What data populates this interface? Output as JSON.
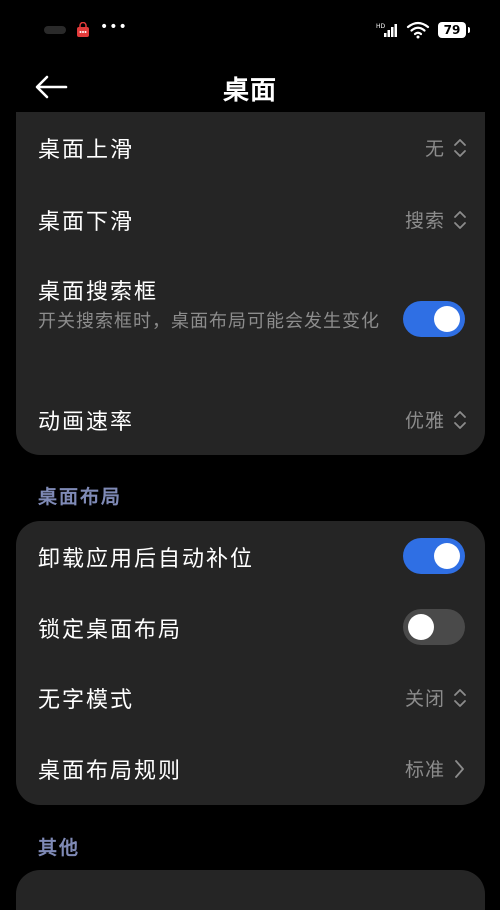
{
  "status_bar": {
    "battery": "79",
    "more_dots": "•••"
  },
  "header": {
    "title": "桌面"
  },
  "general_card": {
    "items": [
      {
        "label": "桌面上滑",
        "value": "无"
      },
      {
        "label": "桌面下滑",
        "value": "搜索"
      },
      {
        "label": "桌面搜索框",
        "description": "开关搜索框时，桌面布局可能会发生变化",
        "enabled": true
      },
      {
        "label": "动画速率",
        "value": "优雅"
      }
    ]
  },
  "layout_section": {
    "header": "桌面布局",
    "items": [
      {
        "label": "卸载应用后自动补位",
        "enabled": true
      },
      {
        "label": "锁定桌面布局",
        "enabled": false
      },
      {
        "label": "无字模式",
        "value": "关闭"
      },
      {
        "label": "桌面布局规则",
        "value": "标准"
      }
    ]
  },
  "other_section": {
    "header": "其他"
  },
  "colors": {
    "background": "#000000",
    "card": "#252525",
    "accent": "#2f6fe4",
    "section_header": "#7f8ab6",
    "secondary_text": "#8c8c8c"
  }
}
